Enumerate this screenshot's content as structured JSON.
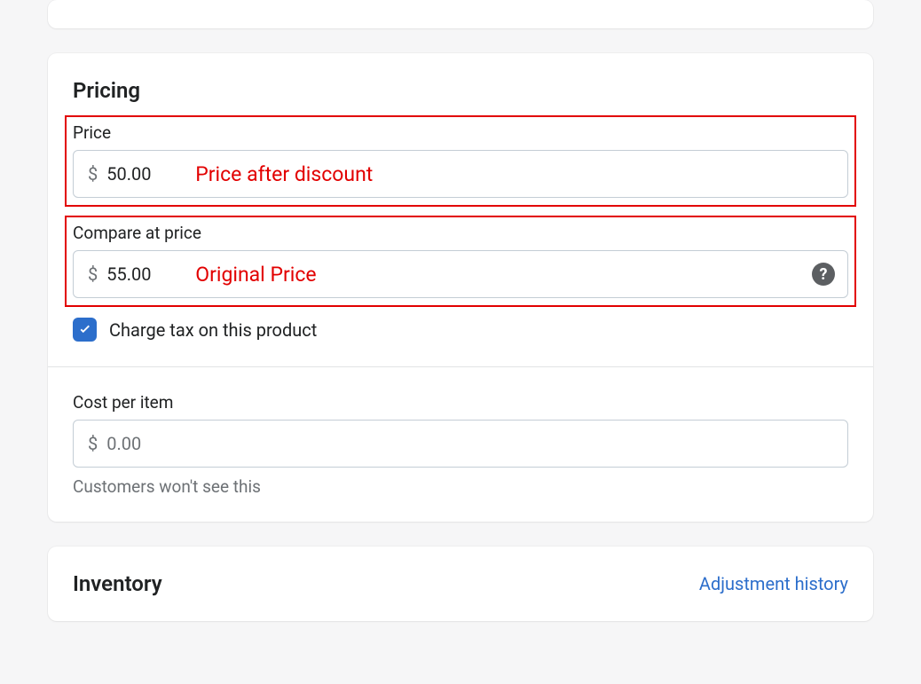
{
  "pricing": {
    "title": "Pricing",
    "price_label": "Price",
    "price_value": "50.00",
    "price_annotation": "Price after discount",
    "compare_label": "Compare at price",
    "compare_value": "55.00",
    "compare_annotation": "Original Price",
    "currency_symbol": "$",
    "tax_checkbox_label": "Charge tax on this product",
    "tax_checked": true,
    "cost_label": "Cost per item",
    "cost_value": "0.00",
    "cost_help_text": "Customers won't see this"
  },
  "inventory": {
    "title": "Inventory",
    "adjustment_link": "Adjustment history"
  },
  "colors": {
    "highlight": "#e20000",
    "primary": "#2c6ecb"
  }
}
